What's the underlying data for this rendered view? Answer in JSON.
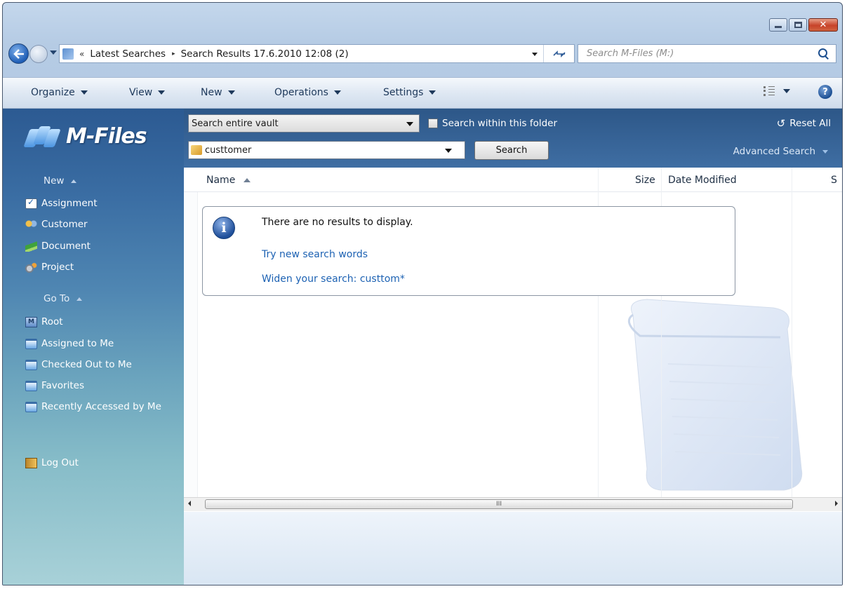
{
  "window": {
    "buttons": {
      "minimize_icon": "minimize-icon",
      "maximize_icon": "maximize-icon",
      "close_glyph": "✕"
    }
  },
  "address": {
    "overflow_chevron": "«",
    "crumbs": [
      "Latest Searches",
      "Search Results 17.6.2010 12:08 (2)"
    ],
    "separator": "▸",
    "search_placeholder": "Search M-Files (M:)"
  },
  "toolbar": {
    "items": [
      "Organize",
      "View",
      "New",
      "Operations",
      "Settings"
    ],
    "help_label": "?"
  },
  "task_pane": {
    "logo_text": "M-Files",
    "new_header": "New",
    "new_items": [
      "Assignment",
      "Customer",
      "Document",
      "Project"
    ],
    "goto_header": "Go To",
    "goto_items": [
      "Root",
      "Assigned to Me",
      "Checked Out to Me",
      "Favorites",
      "Recently Accessed by Me"
    ],
    "root_icon_letter": "M",
    "logout_label": "Log Out"
  },
  "search_panel": {
    "scope_value": "Search entire vault",
    "within_label": "Search within this folder",
    "query_value": "custtomer",
    "search_button": "Search",
    "reset_all": "Reset All",
    "advanced_search": "Advanced Search"
  },
  "list": {
    "columns": [
      "Name",
      "Size",
      "Date Modified",
      "S"
    ],
    "info": {
      "icon_letter": "i",
      "message": "There are no results to display.",
      "link_try": "Try new search words",
      "link_widen": "Widen your search: custtom*"
    },
    "scrollbar_grip": "III"
  },
  "colors": {
    "link": "#1d62b3",
    "pane_top": "#2c5a92",
    "pane_bottom": "#a8d1d8",
    "close_button": "#c7432a"
  }
}
